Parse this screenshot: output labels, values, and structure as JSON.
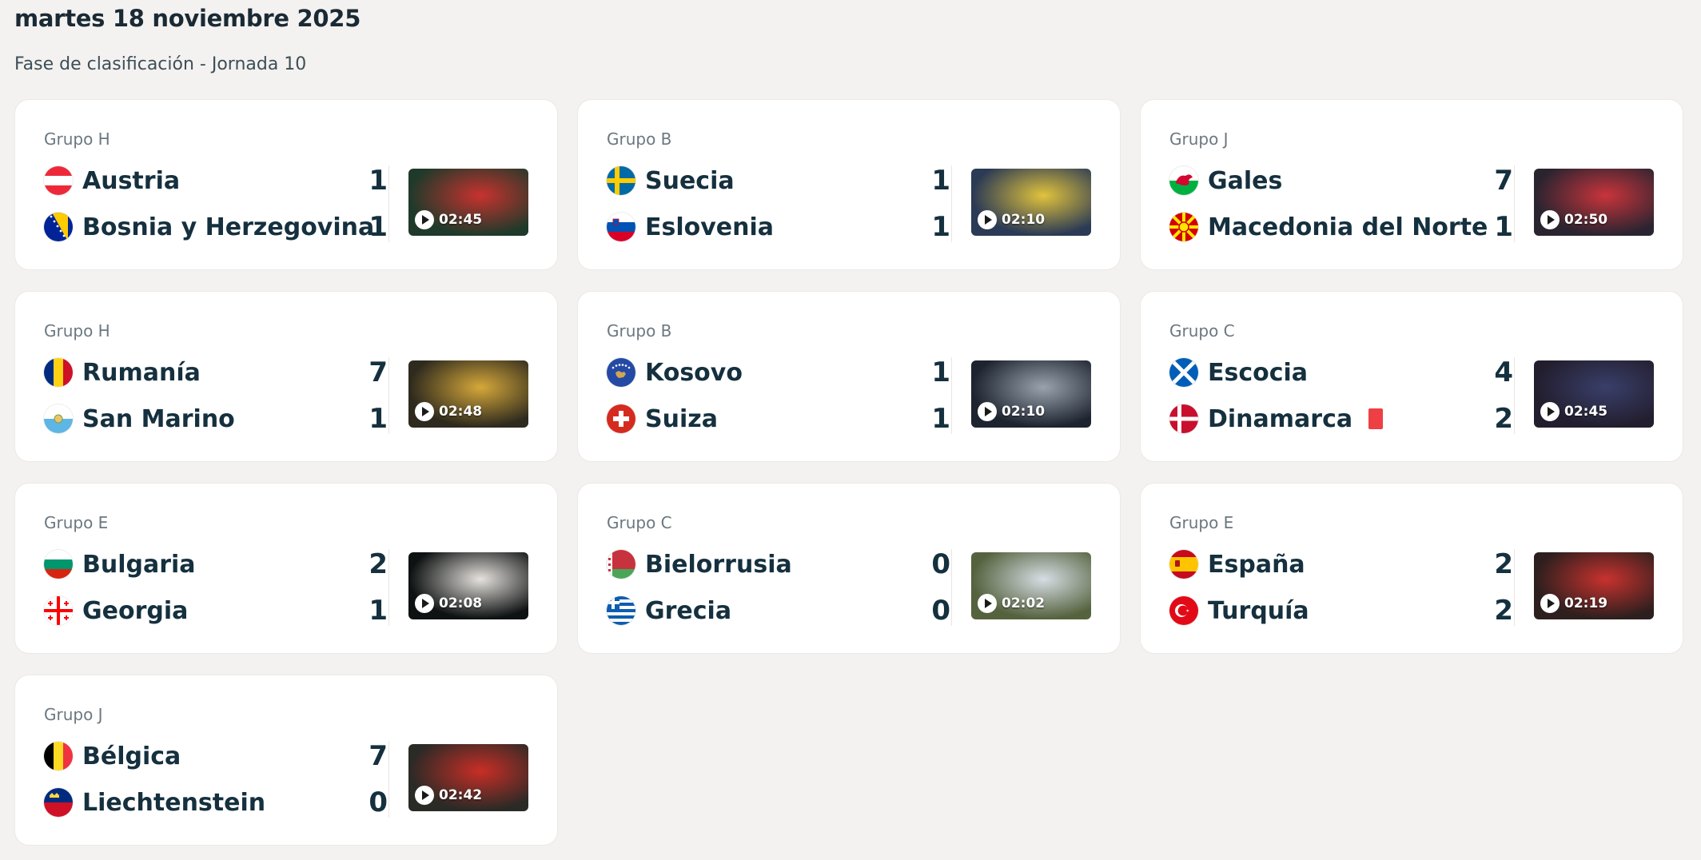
{
  "header": {
    "date": "martes 18 noviembre 2025",
    "phase": "Fase de clasificación - Jornada 10"
  },
  "matches": [
    {
      "group": "Grupo H",
      "home": "Austria",
      "away": "Bosnia y Herzegovina",
      "home_score": "1",
      "away_score": "1",
      "duration": "02:45",
      "home_flag": "austria-flag",
      "away_flag": "bosnia-flag",
      "thumb_colors": [
        "#1f3a2a",
        "#c8322e"
      ]
    },
    {
      "group": "Grupo B",
      "home": "Suecia",
      "away": "Eslovenia",
      "home_score": "1",
      "away_score": "1",
      "duration": "02:10",
      "home_flag": "sweden-flag",
      "away_flag": "slovenia-flag",
      "thumb_colors": [
        "#2b3a55",
        "#e1c33c"
      ]
    },
    {
      "group": "Grupo J",
      "home": "Gales",
      "away": "Macedonia del Norte",
      "home_score": "7",
      "away_score": "1",
      "duration": "02:50",
      "home_flag": "wales-flag",
      "away_flag": "north-macedonia-flag",
      "thumb_colors": [
        "#2a2430",
        "#c9343b"
      ]
    },
    {
      "group": "Grupo H",
      "home": "Rumanía",
      "away": "San Marino",
      "home_score": "7",
      "away_score": "1",
      "duration": "02:48",
      "home_flag": "romania-flag",
      "away_flag": "san-marino-flag",
      "thumb_colors": [
        "#2e2a1e",
        "#d6a83a"
      ]
    },
    {
      "group": "Grupo B",
      "home": "Kosovo",
      "away": "Suiza",
      "home_score": "1",
      "away_score": "1",
      "duration": "02:10",
      "home_flag": "kosovo-flag",
      "away_flag": "switzerland-flag",
      "thumb_colors": [
        "#1d2430",
        "#9aa3ad"
      ]
    },
    {
      "group": "Grupo C",
      "home": "Escocia",
      "away": "Dinamarca",
      "home_score": "4",
      "away_score": "2",
      "duration": "02:45",
      "home_flag": "scotland-flag",
      "away_flag": "denmark-flag",
      "thumb_colors": [
        "#221e2e",
        "#3a3f6a"
      ],
      "away_red_card": true
    },
    {
      "group": "Grupo E",
      "home": "Bulgaria",
      "away": "Georgia",
      "home_score": "2",
      "away_score": "1",
      "duration": "02:08",
      "home_flag": "bulgaria-flag",
      "away_flag": "georgia-flag",
      "thumb_colors": [
        "#0e1212",
        "#e6e2de"
      ]
    },
    {
      "group": "Grupo C",
      "home": "Bielorrusia",
      "away": "Grecia",
      "home_score": "0",
      "away_score": "0",
      "duration": "02:02",
      "home_flag": "belarus-flag",
      "away_flag": "greece-flag",
      "thumb_colors": [
        "#55623e",
        "#d7dde4"
      ]
    },
    {
      "group": "Grupo E",
      "home": "España",
      "away": "Turquía",
      "home_score": "2",
      "away_score": "2",
      "duration": "02:19",
      "home_flag": "spain-flag",
      "away_flag": "turkey-flag",
      "thumb_colors": [
        "#2c1f1e",
        "#c8322e"
      ]
    },
    {
      "group": "Grupo J",
      "home": "Bélgica",
      "away": "Liechtenstein",
      "home_score": "7",
      "away_score": "0",
      "duration": "02:42",
      "home_flag": "belgium-flag",
      "away_flag": "liechtenstein-flag",
      "thumb_colors": [
        "#2a2a26",
        "#c92e26"
      ]
    }
  ]
}
